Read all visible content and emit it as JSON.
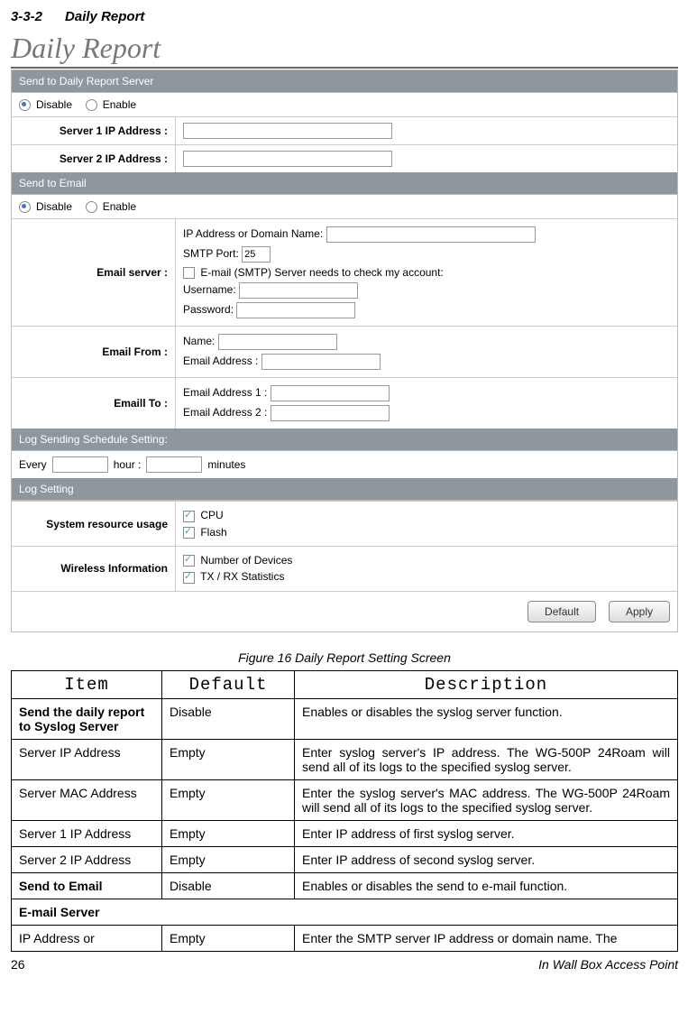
{
  "section": {
    "num": "3-3-2",
    "title": "Daily Report"
  },
  "page_title": "Daily Report",
  "panel": {
    "bar1": "Send to Daily Report Server",
    "disable": "Disable",
    "enable": "Enable",
    "server1": "Server 1 IP Address :",
    "server2": "Server 2 IP Address :",
    "bar2": "Send to Email",
    "email_server_label": "Email server :",
    "ip_or_domain": "IP Address or Domain Name:",
    "smtp_port": "SMTP Port:",
    "smtp_port_val": "25",
    "smtp_check": "E-mail (SMTP) Server needs to check my account:",
    "username": "Username:",
    "password": "Password:",
    "email_from_label": "Email From :",
    "name": "Name:",
    "email_address": "Email Address :",
    "email_to_label": "Emaill To :",
    "email_addr1": "Email Address 1 :",
    "email_addr2": "Email Address 2 :",
    "bar3": "Log Sending Schedule Setting:",
    "every": "Every",
    "hour": "hour :",
    "minutes": "minutes",
    "bar4": "Log Setting",
    "sys_usage": "System resource usage",
    "cpu": "CPU",
    "flash": "Flash",
    "wireless_info": "Wireless Information",
    "num_devices": "Number of Devices",
    "txrx": "TX / RX Statistics",
    "default_btn": "Default",
    "apply_btn": "Apply"
  },
  "caption": "Figure 16 Daily Report Setting Screen",
  "table_headers": {
    "item": "Item",
    "default": "Default",
    "desc": "Description"
  },
  "rows": [
    {
      "item": "Send the daily report to Syslog Server",
      "bold": true,
      "def": "Disable",
      "desc": "Enables or disables the syslog server function."
    },
    {
      "item": "Server IP Address",
      "bold": false,
      "def": "Empty",
      "desc": "Enter syslog server's IP address. The WG-500P 24Roam will send all of its logs to the specified syslog server.",
      "justify": true
    },
    {
      "item": "Server MAC Address",
      "bold": false,
      "def": "Empty",
      "desc": "Enter the syslog server's MAC address. The WG-500P 24Roam will send all of its logs to the specified syslog server.",
      "justify": true
    },
    {
      "item": "Server 1 IP Address",
      "bold": false,
      "def": "Empty",
      "desc": "Enter IP address of first syslog server."
    },
    {
      "item": "Server 2 IP Address",
      "bold": false,
      "def": "Empty",
      "desc": "Enter IP address of second syslog server."
    },
    {
      "item": "Send to Email",
      "bold": true,
      "def": "Disable",
      "desc": "Enables or disables the send to e-mail function."
    },
    {
      "item": "E-mail Server",
      "bold": true,
      "def": "",
      "desc": "",
      "span": true
    },
    {
      "item": "IP Address or",
      "bold": false,
      "def": "Empty",
      "desc": "Enter the SMTP server IP address or domain name. The"
    }
  ],
  "footer": {
    "page": "26",
    "label": "In Wall Box Access Point"
  }
}
